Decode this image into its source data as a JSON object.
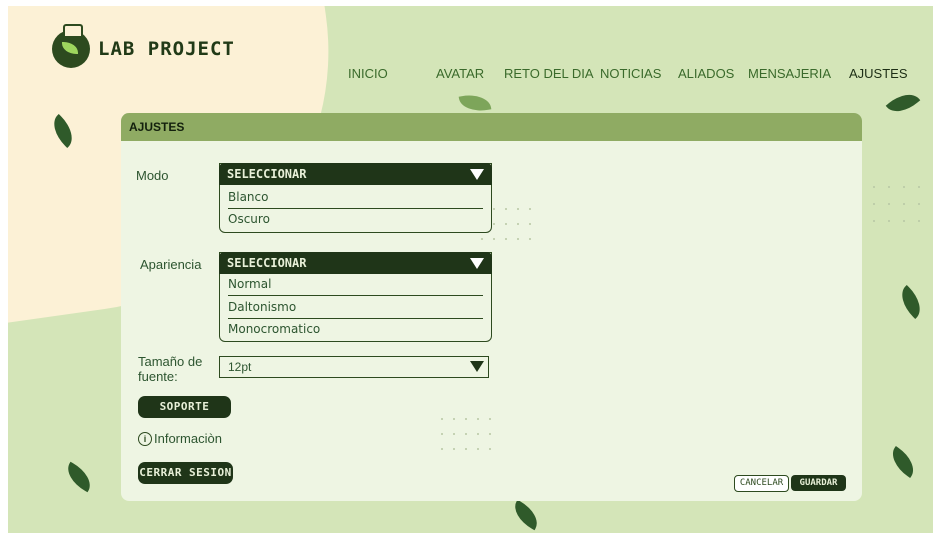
{
  "app": {
    "logo_text": "LAB PROJECT"
  },
  "nav": {
    "items": [
      {
        "label": "INICIO"
      },
      {
        "label": "AVATAR"
      },
      {
        "label": "RETO DEL DIA"
      },
      {
        "label": "NOTICIAS"
      },
      {
        "label": "ALIADOS"
      },
      {
        "label": "MENSAJERIA"
      },
      {
        "label": "AJUSTES",
        "active": true
      }
    ]
  },
  "settings": {
    "header": "AJUSTES",
    "modo": {
      "label": "Modo",
      "selected": "SELECCIONAR",
      "options": [
        "Blanco",
        "Oscuro"
      ]
    },
    "apariencia": {
      "label": "Apariencia",
      "selected": "SELECCIONAR",
      "options": [
        "Normal",
        "Daltonismo",
        "Monocromatico"
      ]
    },
    "font_size": {
      "label": "Tamaño de fuente:",
      "value": "12pt"
    },
    "soporte_label": "SOPORTE",
    "info_label": "Informaciòn",
    "logout_label": "CERRAR SESION",
    "cancel_label": "CANCELAR",
    "save_label": "GUARDAR"
  },
  "colors": {
    "background": "#d4e5b8",
    "cream": "#fcf1d6",
    "panel": "#eef5e3",
    "header_bar": "#8fab63",
    "dark_green": "#1f3518"
  },
  "icons": [
    "flask-logo-icon",
    "leaf-icon",
    "dropdown-triangle-icon",
    "info-icon"
  ]
}
